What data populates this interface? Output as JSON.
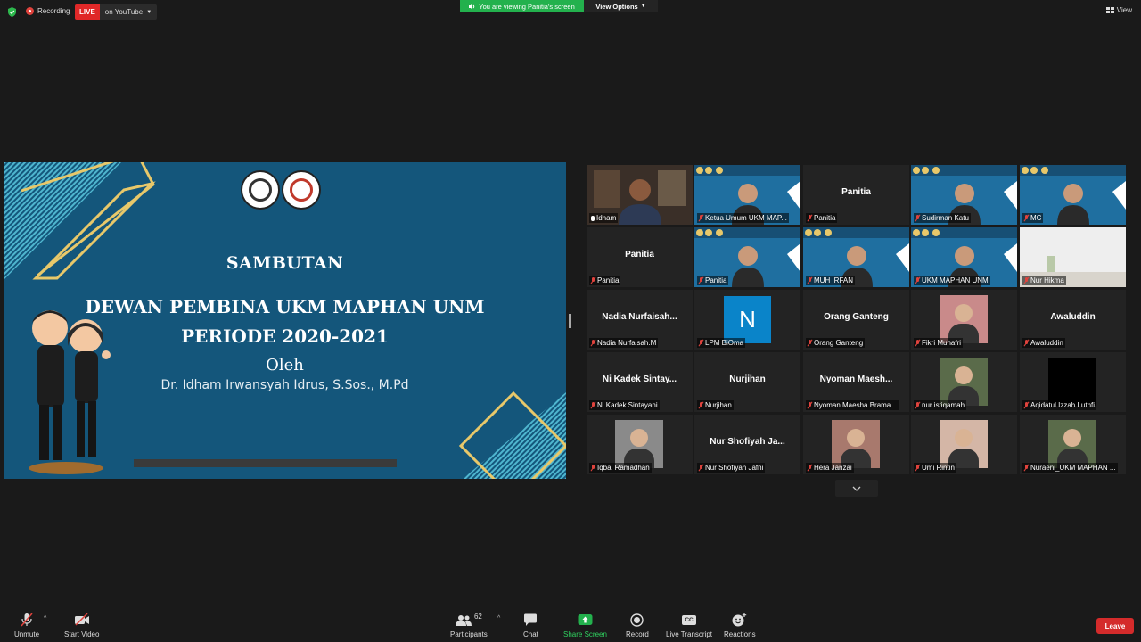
{
  "topbar": {
    "recording_label": "Recording",
    "live_badge": "LIVE",
    "live_destination": "on YouTube",
    "viewing_banner": "You are viewing Panitia's screen",
    "view_options": "View Options",
    "view_label": "View"
  },
  "slide": {
    "heading": "SAMBUTAN",
    "line1": "DEWAN PEMBINA UKM MAPHAN UNM",
    "line2": "PERIODE 2020-2021",
    "by": "Oleh",
    "speaker": "Dr. Idham Irwansyah Idrus, S.Sos., M.Pd"
  },
  "participants_gallery": [
    {
      "label": "Idham",
      "name_center": "",
      "type": "video-office",
      "active": true,
      "muted": false
    },
    {
      "label": "Ketua Umum UKM MAP...",
      "name_center": "",
      "type": "video-banner",
      "muted": true
    },
    {
      "label": "Panitia",
      "name_center": "Panitia",
      "type": "name",
      "muted": true
    },
    {
      "label": "Sudirman Katu",
      "name_center": "",
      "type": "video-banner",
      "muted": true
    },
    {
      "label": "MC",
      "name_center": "",
      "type": "video-banner",
      "muted": true
    },
    {
      "label": "Panitia",
      "name_center": "Panitia",
      "type": "name",
      "muted": true
    },
    {
      "label": "Panitia",
      "name_center": "",
      "type": "video-banner",
      "muted": true
    },
    {
      "label": "MUH IRFAN",
      "name_center": "",
      "type": "video-banner",
      "muted": true
    },
    {
      "label": "UKM MAPHAN UNM",
      "name_center": "",
      "type": "video-banner",
      "muted": true
    },
    {
      "label": "Nur Hikma",
      "name_center": "",
      "type": "video-room",
      "muted": true
    },
    {
      "label": "Nadia Nurfaisah.M",
      "name_center": "Nadia  Nurfaisah...",
      "type": "name",
      "muted": true
    },
    {
      "label": "LPM BiOma",
      "name_center": "N",
      "type": "avatar-letter",
      "muted": true
    },
    {
      "label": "Orang Ganteng",
      "name_center": "Orang Ganteng",
      "type": "name",
      "muted": true
    },
    {
      "label": "Fikri Munafri",
      "name_center": "",
      "type": "photo",
      "muted": true
    },
    {
      "label": "Awaluddin",
      "name_center": "Awaluddin",
      "type": "name",
      "muted": true
    },
    {
      "label": "Ni Kadek Sintayani",
      "name_center": "Ni Kadek Sintay...",
      "type": "name",
      "muted": true
    },
    {
      "label": "Nurjihan",
      "name_center": "Nurjihan",
      "type": "name",
      "muted": true
    },
    {
      "label": "Nyoman Maesha Brama...",
      "name_center": "Nyoman  Maesh...",
      "type": "name",
      "muted": true
    },
    {
      "label": "nur istiqamah",
      "name_center": "",
      "type": "photo",
      "muted": true
    },
    {
      "label": "Aqidatul Izzah Luthfi",
      "name_center": "",
      "type": "photo-black",
      "muted": true
    },
    {
      "label": "Iqbal Ramadhan",
      "name_center": "",
      "type": "photo",
      "muted": true
    },
    {
      "label": "Nur Shofiyah Jafni",
      "name_center": "Nur Shofiyah Ja...",
      "type": "name",
      "muted": true
    },
    {
      "label": "Hera Janzai",
      "name_center": "",
      "type": "photo",
      "muted": true
    },
    {
      "label": "Umi Rintin",
      "name_center": "",
      "type": "photo",
      "muted": true
    },
    {
      "label": "Nuraeni_UKM MAPHAN ...",
      "name_center": "",
      "type": "photo",
      "muted": true
    }
  ],
  "toolbar": {
    "unmute": "Unmute",
    "start_video": "Start Video",
    "participants": "Participants",
    "participants_count": "62",
    "chat": "Chat",
    "share_screen": "Share Screen",
    "record": "Record",
    "live_transcript": "Live Transcript",
    "live_transcript_icon_text": "CC",
    "reactions": "Reactions",
    "leave": "Leave"
  },
  "colors": {
    "slide_bg": "#14567b",
    "accent_gold": "#e8c86a",
    "accent_cyan": "#4fb6cf",
    "live_red": "#e02828",
    "share_green": "#23b14d",
    "leave_red": "#d42b2b",
    "active_speaker": "#c9d84a"
  }
}
